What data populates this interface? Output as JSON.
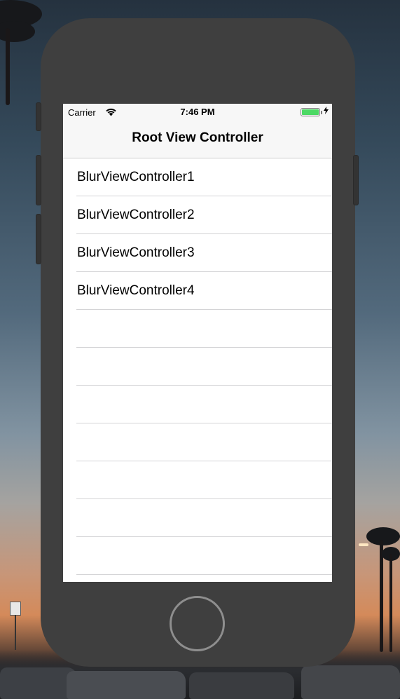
{
  "status_bar": {
    "carrier": "Carrier",
    "time": "7:46 PM",
    "wifi_icon": "wifi-icon",
    "battery_icon": "battery-icon",
    "battery_level": 1.0,
    "charging_icon": "charging-bolt-icon",
    "battery_color": "#4cd964"
  },
  "nav_bar": {
    "title": "Root View Controller"
  },
  "table": {
    "rows": [
      {
        "label": "BlurViewController1"
      },
      {
        "label": "BlurViewController2"
      },
      {
        "label": "BlurViewController3"
      },
      {
        "label": "BlurViewController4"
      },
      {
        "label": ""
      },
      {
        "label": ""
      },
      {
        "label": ""
      },
      {
        "label": ""
      },
      {
        "label": ""
      },
      {
        "label": ""
      },
      {
        "label": ""
      }
    ]
  },
  "device": {
    "body_color": "#3f3f3f",
    "home_button_icon": "home-button"
  }
}
